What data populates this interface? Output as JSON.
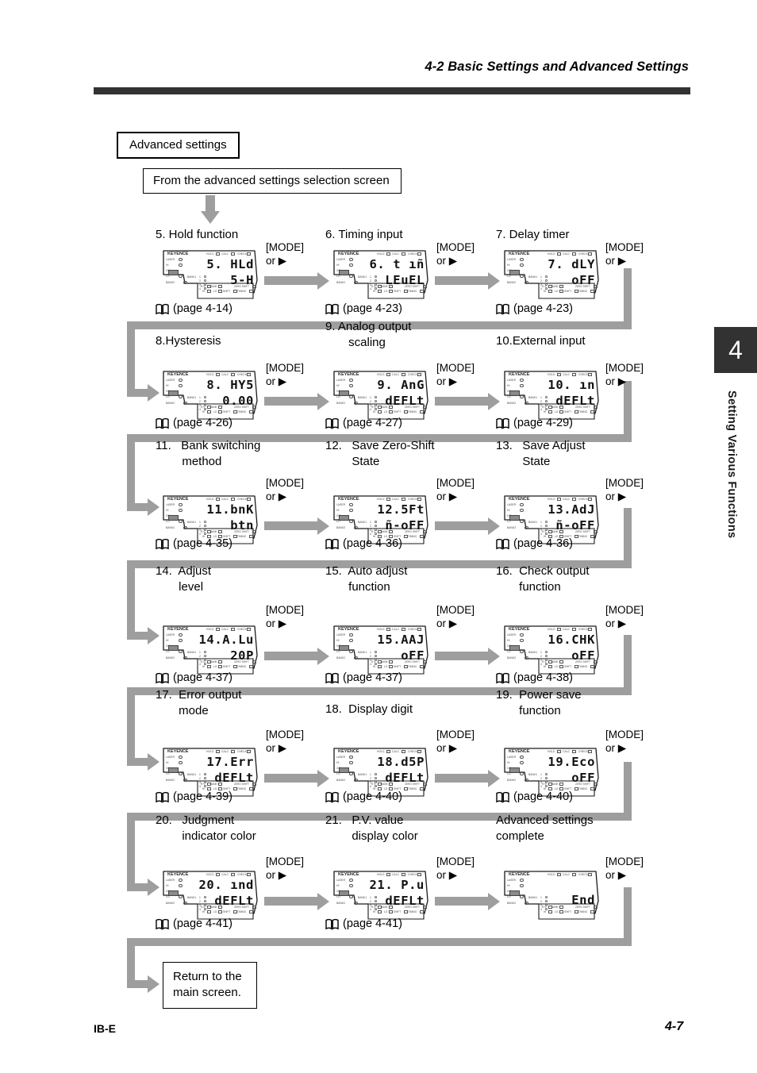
{
  "header": {
    "title": "4-2  Basic Settings and Advanced Settings"
  },
  "sidebar": {
    "chapter_number": "4",
    "chapter_label": "Setting Various Functions"
  },
  "footer": {
    "left": "IB-E",
    "right": "4-7"
  },
  "boxes": {
    "advanced_settings": "Advanced settings",
    "from_screen": "From the advanced settings selection screen",
    "return_line1": "Return to the",
    "return_line2": "main screen."
  },
  "mode_label": {
    "line1": "[MODE]",
    "line2": "or ▶"
  },
  "lcd_chrome": {
    "brand": "KEYENCE",
    "top_labels": [
      "HOLD",
      "CALC",
      "CHECK"
    ],
    "side_labels": [
      "LASER",
      "HI",
      "GO",
      "LO",
      "BANK"
    ],
    "bottom_labels": [
      "R.V",
      "BANK",
      "HI",
      "LO",
      "SHIFT",
      "ZERO SHIFT",
      "TIMING"
    ]
  },
  "steps": [
    {
      "num": "5.",
      "title_lines": [
        "Hold function"
      ],
      "seg1": "5. HLd",
      "seg2": "5-H",
      "page": "(page 4-14)"
    },
    {
      "num": "6.",
      "title_lines": [
        "Timing input"
      ],
      "seg1": "6. t ıñ",
      "seg2": "LEuEL",
      "page": "(page 4-23)"
    },
    {
      "num": "7.",
      "title_lines": [
        "Delay timer"
      ],
      "seg1": "7. dLY",
      "seg2": "oFF",
      "page": "(page 4-23)"
    },
    {
      "num": "8.",
      "title_lines": [
        "Hysteresis"
      ],
      "seg1": "8. HY5",
      "seg2": "0.00",
      "page": "(page 4-26)"
    },
    {
      "num": "9.",
      "title_lines": [
        "Analog output",
        "scaling"
      ],
      "seg1": "9. AnG",
      "seg2": "dEFLt",
      "page": "(page 4-27)"
    },
    {
      "num": "10.",
      "title_lines": [
        "External input"
      ],
      "seg1": "10. ın",
      "seg2": "dEFLt",
      "page": "(page 4-29)"
    },
    {
      "num": "11.",
      "title_lines": [
        "Bank switching",
        "method"
      ],
      "seg1": "11.bnK",
      "seg2": "btn",
      "page": "(page 4-35)"
    },
    {
      "num": "12.",
      "title_lines": [
        "Save Zero-Shift",
        "State"
      ],
      "seg1": "12.5Ft",
      "seg2": "ñ-oFF",
      "page": "(page 4-36)"
    },
    {
      "num": "13.",
      "title_lines": [
        "Save Adjust",
        "State"
      ],
      "seg1": "13.AdJ",
      "seg2": "ñ-oFF",
      "page": "(page 4-36)"
    },
    {
      "num": "14.",
      "title_lines": [
        "Adjust",
        "level"
      ],
      "seg1": "14.A.Lu",
      "seg2": "20P",
      "page": "(page 4-37)"
    },
    {
      "num": "15.",
      "title_lines": [
        "Auto adjust",
        "function"
      ],
      "seg1": "15.AAJ",
      "seg2": "oFF",
      "page": "(page 4-37)"
    },
    {
      "num": "16.",
      "title_lines": [
        "Check output",
        "function"
      ],
      "seg1": "16.CHK",
      "seg2": "oFF",
      "page": "(page 4-38)"
    },
    {
      "num": "17.",
      "title_lines": [
        "Error output",
        "mode"
      ],
      "seg1": "17.Err",
      "seg2": "dEFLt",
      "page": "(page 4-39)"
    },
    {
      "num": "18.",
      "title_lines": [
        "Display digit"
      ],
      "seg1": "18.d5P",
      "seg2": "dEFLt",
      "page": "(page 4-40)"
    },
    {
      "num": "19.",
      "title_lines": [
        "Power save",
        "function"
      ],
      "seg1": "19.Eco",
      "seg2": "oFF",
      "page": "(page 4-40)"
    },
    {
      "num": "20.",
      "title_lines": [
        "Judgment",
        "indicator color"
      ],
      "seg1": "20. ınd",
      "seg2": "dEFLt",
      "page": "(page 4-41)"
    },
    {
      "num": "21.",
      "title_lines": [
        "P.V. value",
        "display color"
      ],
      "seg1": "21. P.u",
      "seg2": "dEFLt",
      "page": "(page 4-41)"
    },
    {
      "num": "",
      "title_lines": [
        "Advanced settings",
        "complete"
      ],
      "seg1": "End",
      "seg2": "",
      "page": ""
    }
  ],
  "titles": {
    "t0": "5. Hold function",
    "t1": "6. Timing input",
    "t2": "7. Delay timer",
    "t3": "8.Hysteresis",
    "t4": "9. Analog output\n       scaling",
    "t5": "10.External input",
    "t6": "11.   Bank switching\n        method",
    "t7": "12.   Save Zero-Shift\n        State",
    "t8": "13.   Save Adjust\n        State",
    "t9": "14.  Adjust\n       level",
    "t10": "15.  Auto adjust\n       function",
    "t11": "16.  Check output\n       function",
    "t12": "17.  Error output\n       mode",
    "t13": "18.  Display digit",
    "t14": "19.  Power save\n       function",
    "t15": "20.   Judgment\n        indicator color",
    "t16": "21.   P.V. value\n        display color",
    "t17": "Advanced settings\ncomplete"
  },
  "colors": {
    "flow_gray": "#9e9e9e",
    "rule_dark": "#323232",
    "ink": "#000000"
  }
}
